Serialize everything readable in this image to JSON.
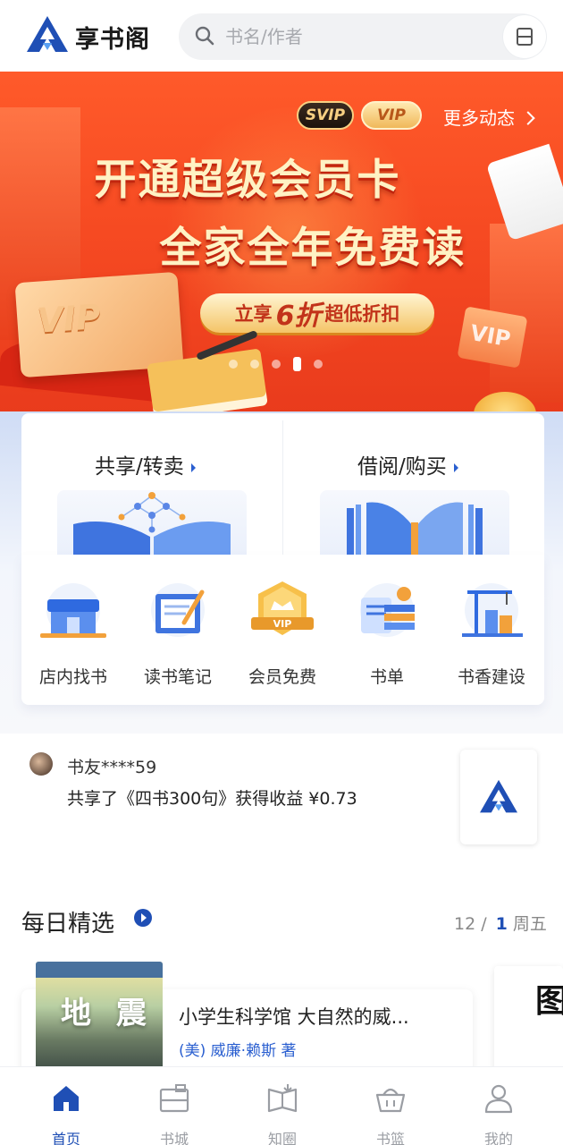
{
  "header": {
    "app_name": "享书阁",
    "search_placeholder": "书名/作者"
  },
  "banner": {
    "svip_label": "SVIP",
    "vip_label": "VIP",
    "more_label": "更多动态",
    "headline_1": "开通超级会员卡",
    "headline_2": "全家全年免费读",
    "discount_pre": "立享",
    "discount_num": "6折",
    "discount_post": "超低折扣",
    "card_vip": "VIP",
    "slide_index": 4,
    "slide_count": 5
  },
  "features": {
    "share": "共享/转卖",
    "borrow": "借阅/购买"
  },
  "quick_links": [
    {
      "label": "店内找书",
      "icon": "bookstore-icon"
    },
    {
      "label": "读书笔记",
      "icon": "notebook-icon"
    },
    {
      "label": "会员免费",
      "icon": "vip-badge-icon"
    },
    {
      "label": "书单",
      "icon": "booklist-icon"
    },
    {
      "label": "书香建设",
      "icon": "construction-icon"
    }
  ],
  "notice": {
    "user": "书友****59",
    "message": "共享了《四书300句》获得收益 ¥0.73"
  },
  "daily": {
    "title": "每日精选",
    "month": "12 /",
    "day": "1",
    "weekday": "周五",
    "book": {
      "title": "小学生科学馆  大自然的威...",
      "author": "(美) 威廉·赖斯 著",
      "cover_text": "地 震"
    }
  },
  "tabs": [
    {
      "label": "首页",
      "active": true
    },
    {
      "label": "书城",
      "active": false
    },
    {
      "label": "知圈",
      "active": false
    },
    {
      "label": "书篮",
      "active": false
    },
    {
      "label": "我的",
      "active": false
    }
  ],
  "colors": {
    "brand_blue": "#1f4fb5",
    "banner_red": "#f64a22",
    "gold": "#f7cf82"
  }
}
